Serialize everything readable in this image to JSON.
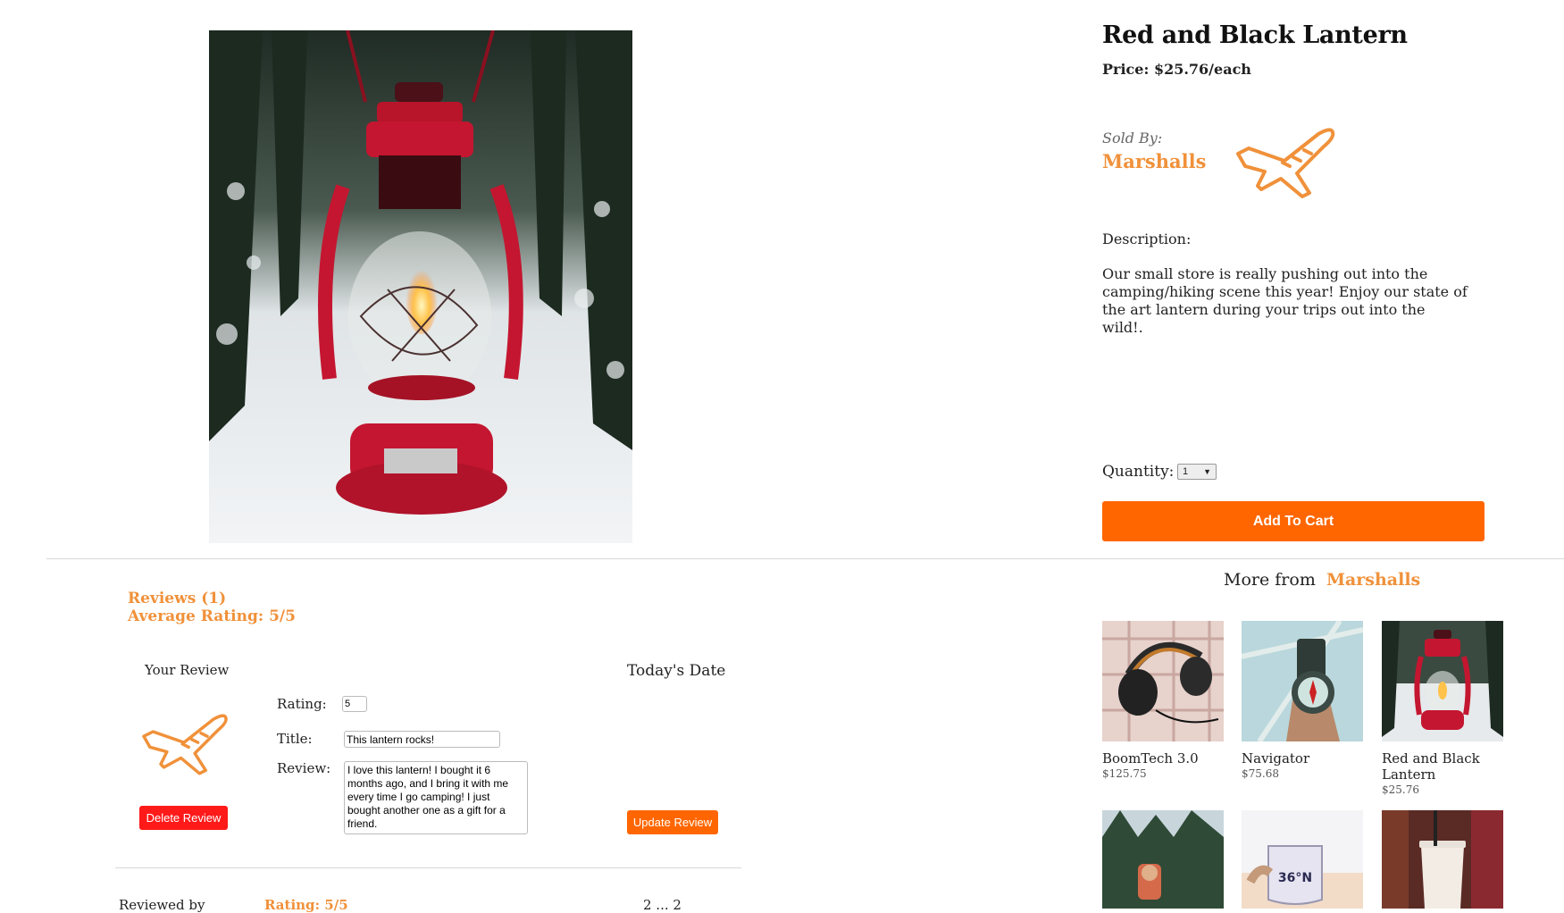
{
  "product": {
    "title": "Red and Black Lantern",
    "price": "Price: $25.76/each",
    "sold_by_label": "Sold By:",
    "seller": "Marshalls",
    "description_label": "Description:",
    "description": "Our small store is really pushing out into the camping/hiking scene this year! Enjoy our state of the art lantern during your trips out into the wild!.",
    "quantity_label": "Quantity:",
    "quantity_value": "1",
    "add_to_cart_label": "Add To Cart"
  },
  "reviews": {
    "count_label": "Reviews (1)",
    "average_label": "Average Rating: 5/5",
    "your_review_label": "Your Review",
    "todays_date_label": "Today's Date",
    "rating_label": "Rating:",
    "rating_value": "5",
    "title_label": "Title:",
    "title_value": "This lantern rocks!",
    "review_label": "Review:",
    "review_value": "I love this lantern! I bought it 6 months ago, and I bring it with me every time I go camping! I just bought another one as a gift for a friend.",
    "delete_label": "Delete Review",
    "update_label": "Update Review",
    "next_row": {
      "author": "Reviewed by",
      "rating": "Rating: 5/5",
      "date": "2 ... 2"
    }
  },
  "more_from": {
    "prefix": "More from",
    "seller": "Marshalls",
    "items": [
      {
        "name": "BoomTech 3.0",
        "price": "$125.75"
      },
      {
        "name": "Navigator",
        "price": "$75.68"
      },
      {
        "name": "Red and Black Lantern",
        "price": "$25.76"
      }
    ]
  },
  "colors": {
    "accent": "#f0913a",
    "cart_button": "#ff6600",
    "delete_button": "#ff1a1a"
  },
  "icons": {
    "seller_logo": "airplane-icon",
    "review_avatar": "airplane-icon"
  }
}
